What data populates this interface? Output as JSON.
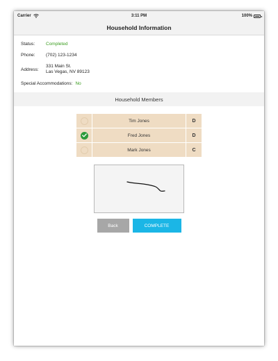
{
  "status_bar": {
    "carrier": "Carrier",
    "time": "3:11 PM",
    "battery": "100%"
  },
  "navbar": {
    "title": "Household Information"
  },
  "info": {
    "status_label": "Status:",
    "status_value": "Completed",
    "phone_label": "Phone:",
    "phone_value": "(702) 123-1234",
    "address_label": "Address:",
    "address_line1": "331 Main St.",
    "address_line2": "Las Vegas, NV 89123",
    "accommodations_label": "Special Accommodations:",
    "accommodations_value": "No"
  },
  "members_section": {
    "title": "Household Members",
    "members": [
      {
        "name": "Tim Jones",
        "code": "D",
        "checked": false
      },
      {
        "name": "Fred Jones",
        "code": "D",
        "checked": true
      },
      {
        "name": "Mark Jones",
        "code": "C",
        "checked": false
      }
    ]
  },
  "buttons": {
    "back_label": "Back",
    "complete_label": "COMPLETE"
  },
  "colors": {
    "accent": "#1bb6e6",
    "success": "#2c9b3c",
    "status_green": "#3a9d1f",
    "member_row": "#efdcc3",
    "back_button": "#a7a7a7"
  }
}
